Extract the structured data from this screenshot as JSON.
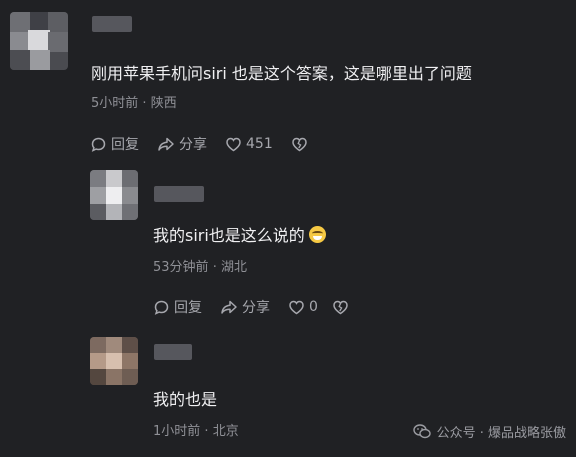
{
  "comments": [
    {
      "text": "刚用苹果手机问siri 也是这个答案，这是哪里出了问题",
      "time": "5小时前",
      "location": "陕西",
      "reply": "回复",
      "share": "分享",
      "likes": "451"
    },
    {
      "text": "我的siri也是这么说的",
      "time": "53分钟前",
      "location": "湖北",
      "reply": "回复",
      "share": "分享",
      "likes": "0"
    },
    {
      "text": "我的也是",
      "time": "1小时前",
      "location": "北京"
    }
  ],
  "separator": "·",
  "watermark": {
    "text": "公众号 · 爆品战略张傲"
  },
  "icons": [
    "reply-bubble-icon",
    "share-arrow-icon",
    "heart-icon",
    "broken-heart-icon",
    "grinning-sweat-emoji",
    "wechat-icon"
  ]
}
